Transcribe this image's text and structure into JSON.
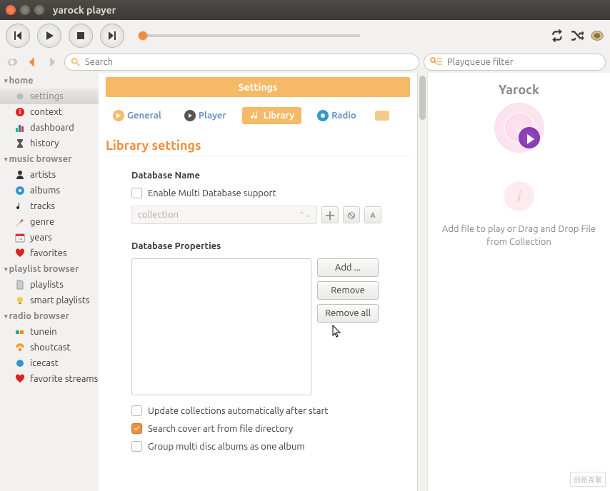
{
  "window": {
    "title": "yarock player"
  },
  "search": {
    "placeholder": "Search"
  },
  "filter": {
    "placeholder": "Playqueue filter"
  },
  "sidebar": {
    "groups": [
      {
        "label": "home",
        "items": [
          {
            "label": "settings",
            "icon": "gear"
          },
          {
            "label": "context",
            "icon": "info"
          },
          {
            "label": "dashboard",
            "icon": "bars"
          },
          {
            "label": "history",
            "icon": "hourglass"
          }
        ]
      },
      {
        "label": "music browser",
        "items": [
          {
            "label": "artists",
            "icon": "person"
          },
          {
            "label": "albums",
            "icon": "disc"
          },
          {
            "label": "tracks",
            "icon": "note"
          },
          {
            "label": "genre",
            "icon": "violin"
          },
          {
            "label": "years",
            "icon": "calendar"
          },
          {
            "label": "favorites",
            "icon": "heart"
          }
        ]
      },
      {
        "label": "playlist browser",
        "items": [
          {
            "label": "playlists",
            "icon": "file"
          },
          {
            "label": "smart playlists",
            "icon": "bulb"
          }
        ]
      },
      {
        "label": "radio browser",
        "items": [
          {
            "label": "tunein",
            "icon": "tunein"
          },
          {
            "label": "shoutcast",
            "icon": "shout"
          },
          {
            "label": "icecast",
            "icon": "ice"
          },
          {
            "label": "favorite streams",
            "icon": "heart"
          }
        ]
      }
    ]
  },
  "main": {
    "banner": "Settings",
    "tabs": [
      {
        "label": "General"
      },
      {
        "label": "Player"
      },
      {
        "label": "Library"
      },
      {
        "label": "Radio"
      }
    ],
    "section": "Library settings",
    "db_name_label": "Database Name",
    "enable_multi": "Enable Multi Database support",
    "dropdown_value": "collection",
    "db_props_label": "Database Properties",
    "btn_add": "Add ...",
    "btn_remove": "Remove",
    "btn_remove_all": "Remove all",
    "opt_update": "Update collections automatically after start",
    "opt_cover": "Search cover art from file directory",
    "opt_group": "Group multi disc albums as one album"
  },
  "right": {
    "title": "Yarock",
    "info": "i",
    "hint": "Add file to play or Drag and Drop File from Collection"
  },
  "watermark": "创新互联"
}
